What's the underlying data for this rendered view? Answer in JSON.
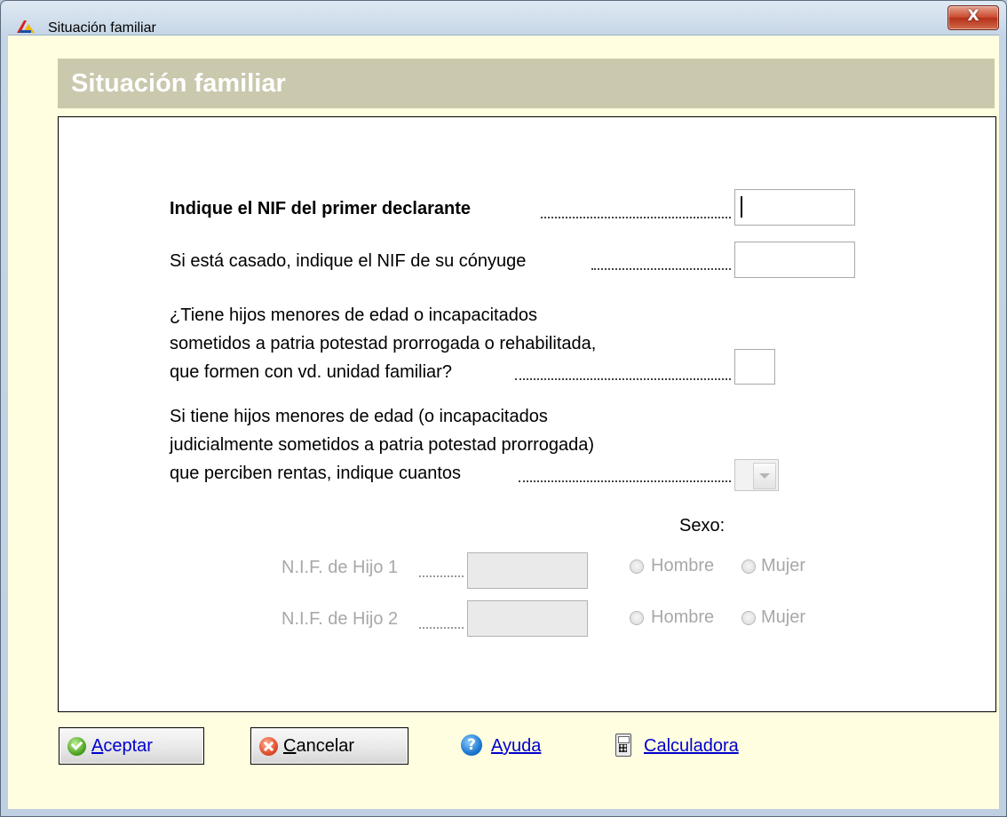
{
  "window": {
    "title": "Situación familiar",
    "close_label": "X"
  },
  "header": {
    "title": "Situación familiar"
  },
  "form": {
    "q1_label": "Indique el NIF del primer declarante",
    "q1_value": "",
    "q2_label": "Si está casado, indique el NIF de su cónyuge",
    "q2_value": "",
    "q3_lines": [
      "¿Tiene hijos menores de edad o incapacitados",
      "sometidos a patria potestad prorrogada o rehabilitada,",
      "que formen con vd. unidad familiar?"
    ],
    "q3_value": "",
    "q4_lines": [
      "Si tiene hijos menores de edad (o incapacitados",
      "judicialmente sometidos a patria potestad prorrogada)",
      "que perciben rentas, indique cuantos"
    ],
    "q4_value": "",
    "sexo_label": "Sexo:",
    "children": [
      {
        "label": "N.I.F. de Hijo 1",
        "value": "",
        "male": "Hombre",
        "female": "Mujer"
      },
      {
        "label": "N.I.F. de Hijo 2",
        "value": "",
        "male": "Hombre",
        "female": "Mujer"
      }
    ]
  },
  "footer": {
    "accept_first": "A",
    "accept_rest": "ceptar",
    "cancel_first": "C",
    "cancel_rest": "ancelar",
    "help": "Ayuda",
    "calculator": "Calculadora"
  }
}
